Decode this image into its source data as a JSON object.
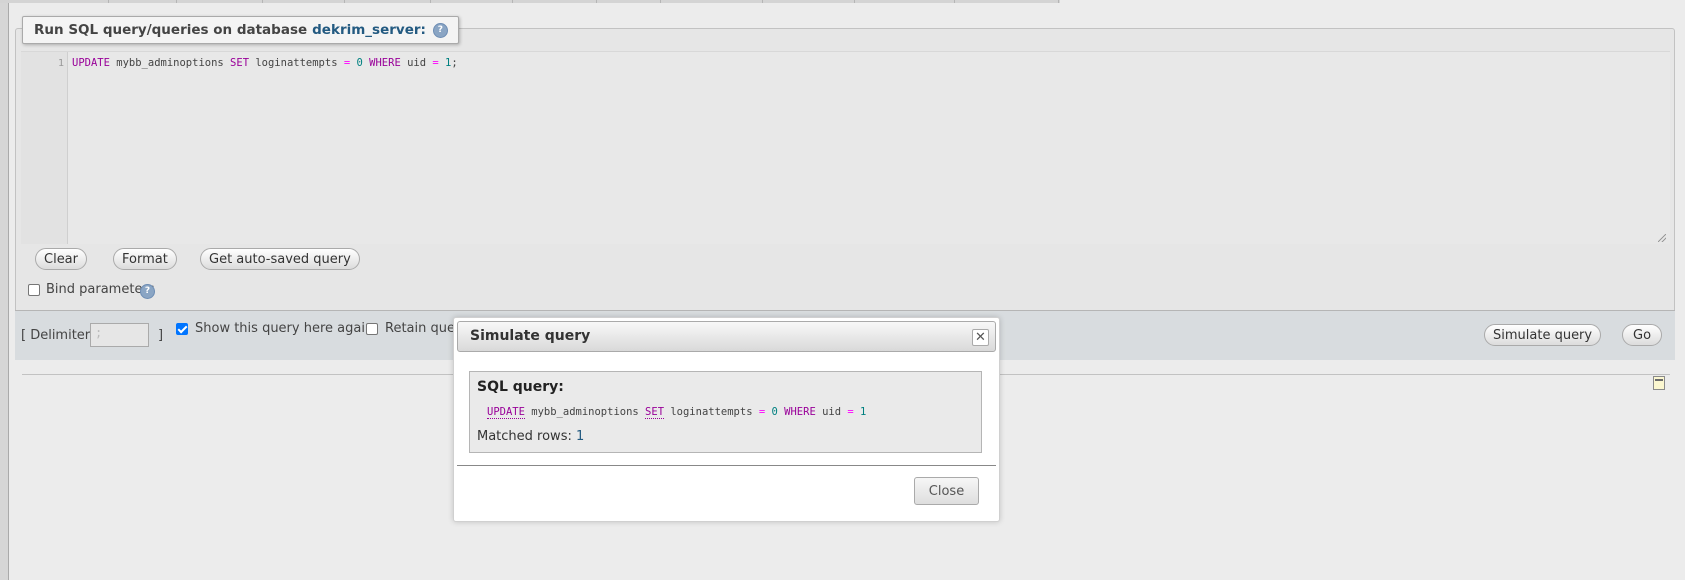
{
  "sql_panel": {
    "legend_prefix": "Run SQL query/queries on database",
    "database_name": "dekrim_server:",
    "help_icon": "help-icon",
    "editor": {
      "line_number": "1",
      "code": {
        "k1": "UPDATE",
        "t1": " mybb_adminoptions ",
        "k2": "SET",
        "t2": " loginattempts ",
        "op1": "=",
        "sp1": " ",
        "n1": "0",
        "sp2": " ",
        "k3": "WHERE",
        "t3": " uid ",
        "op2": "=",
        "sp3": " ",
        "n2": "1",
        "end": ";"
      }
    },
    "buttons": {
      "clear": "Clear",
      "format": "Format",
      "auto_saved": "Get auto-saved query"
    },
    "bind_parameters": {
      "label": "Bind parameters",
      "checked": false
    }
  },
  "bottom_bar": {
    "delimiter_open": "[ Delimiter",
    "delimiter_value": ";",
    "delimiter_close": "]",
    "show_query_again": {
      "label": "Show this query here again",
      "checked": true
    },
    "retain_query": {
      "label": "Retain quer",
      "checked": false
    },
    "simulate_button": "Simulate query",
    "go_button": "Go"
  },
  "dialog": {
    "title": "Simulate query",
    "close_icon": "close-icon",
    "sql_heading": "SQL query:",
    "sql": {
      "k1": "UPDATE",
      "t1": " mybb_adminoptions ",
      "k2": "SET",
      "t2": " loginattempts ",
      "op1": "=",
      "sp1": " ",
      "n1": "0",
      "sp2": " ",
      "k3": "WHERE",
      "t3": " uid ",
      "op2": "=",
      "sp3": " ",
      "n2": "1"
    },
    "matched_label": "Matched rows:",
    "matched_value": "1",
    "close_button": "Close"
  },
  "colors": {
    "keyword": "#990099",
    "operator": "#ff00ff",
    "number": "#008080",
    "link": "#235a81",
    "checkbox": "#0075ff"
  }
}
